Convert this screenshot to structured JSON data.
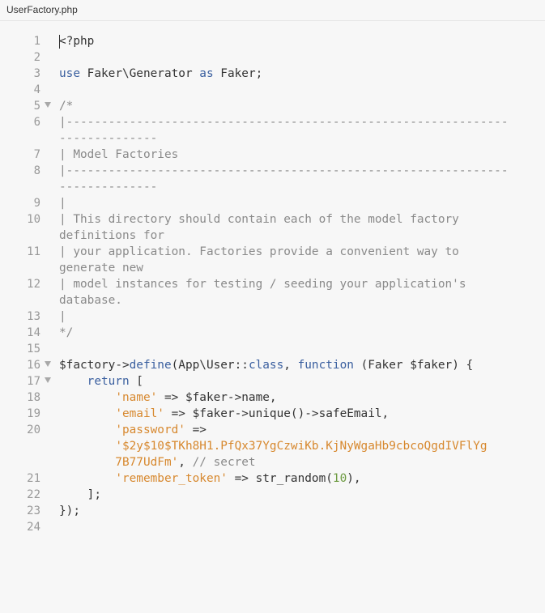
{
  "tab": {
    "title": "UserFactory.php"
  },
  "editor": {
    "lines": [
      {
        "num": "1",
        "fold": false,
        "rows": 1,
        "caret": true,
        "tokens": [
          {
            "t": "<?php",
            "c": "plain"
          }
        ]
      },
      {
        "num": "2",
        "fold": false,
        "rows": 1,
        "tokens": []
      },
      {
        "num": "3",
        "fold": false,
        "rows": 1,
        "tokens": [
          {
            "t": "use",
            "c": "kw"
          },
          {
            "t": " Faker\\Generator ",
            "c": "plain"
          },
          {
            "t": "as",
            "c": "kw"
          },
          {
            "t": " Faker;",
            "c": "plain"
          }
        ]
      },
      {
        "num": "4",
        "fold": false,
        "rows": 1,
        "tokens": []
      },
      {
        "num": "5",
        "fold": true,
        "rows": 1,
        "tokens": [
          {
            "t": "/*",
            "c": "com"
          }
        ]
      },
      {
        "num": "6",
        "fold": false,
        "rows": 2,
        "tokens": [
          {
            "t": "|---------------------------------------------------------------\n--------------",
            "c": "com"
          }
        ]
      },
      {
        "num": "7",
        "fold": false,
        "rows": 1,
        "tokens": [
          {
            "t": "| Model Factories",
            "c": "com"
          }
        ]
      },
      {
        "num": "8",
        "fold": false,
        "rows": 2,
        "tokens": [
          {
            "t": "|---------------------------------------------------------------\n--------------",
            "c": "com"
          }
        ]
      },
      {
        "num": "9",
        "fold": false,
        "rows": 1,
        "tokens": [
          {
            "t": "|",
            "c": "com"
          }
        ]
      },
      {
        "num": "10",
        "fold": false,
        "rows": 2,
        "tokens": [
          {
            "t": "| This directory should contain each of the model factory\ndefinitions for",
            "c": "com"
          }
        ]
      },
      {
        "num": "11",
        "fold": false,
        "rows": 2,
        "tokens": [
          {
            "t": "| your application. Factories provide a convenient way to\ngenerate new",
            "c": "com"
          }
        ]
      },
      {
        "num": "12",
        "fold": false,
        "rows": 2,
        "tokens": [
          {
            "t": "| model instances for testing / seeding your application's\ndatabase.",
            "c": "com"
          }
        ]
      },
      {
        "num": "13",
        "fold": false,
        "rows": 1,
        "tokens": [
          {
            "t": "|",
            "c": "com"
          }
        ]
      },
      {
        "num": "14",
        "fold": false,
        "rows": 1,
        "tokens": [
          {
            "t": "*/",
            "c": "com"
          }
        ]
      },
      {
        "num": "15",
        "fold": false,
        "rows": 1,
        "tokens": []
      },
      {
        "num": "16",
        "fold": true,
        "rows": 1,
        "tokens": [
          {
            "t": "$factory",
            "c": "var"
          },
          {
            "t": "->",
            "c": "plain"
          },
          {
            "t": "define",
            "c": "kw"
          },
          {
            "t": "(App\\User::",
            "c": "plain"
          },
          {
            "t": "class",
            "c": "kw"
          },
          {
            "t": ", ",
            "c": "plain"
          },
          {
            "t": "function",
            "c": "kw"
          },
          {
            "t": " (Faker $faker) {",
            "c": "plain"
          }
        ]
      },
      {
        "num": "17",
        "fold": true,
        "rows": 1,
        "tokens": [
          {
            "t": "    ",
            "c": "plain"
          },
          {
            "t": "return",
            "c": "kw"
          },
          {
            "t": " [",
            "c": "plain"
          }
        ]
      },
      {
        "num": "18",
        "fold": false,
        "rows": 1,
        "tokens": [
          {
            "t": "        ",
            "c": "plain"
          },
          {
            "t": "'name'",
            "c": "str"
          },
          {
            "t": " => $faker->name,",
            "c": "plain"
          }
        ]
      },
      {
        "num": "19",
        "fold": false,
        "rows": 1,
        "tokens": [
          {
            "t": "        ",
            "c": "plain"
          },
          {
            "t": "'email'",
            "c": "str"
          },
          {
            "t": " => $faker->unique()->safeEmail,",
            "c": "plain"
          }
        ]
      },
      {
        "num": "20",
        "fold": false,
        "rows": 3,
        "tokens": [
          {
            "t": "        ",
            "c": "plain"
          },
          {
            "t": "'password'",
            "c": "str"
          },
          {
            "t": " =>\n        ",
            "c": "plain"
          },
          {
            "t": "'$2y$10$TKh8H1.PfQx37YgCzwiKb.KjNyWgaHb9cbcoQgdIVFlYg\n        7B77UdFm'",
            "c": "str"
          },
          {
            "t": ", ",
            "c": "plain"
          },
          {
            "t": "// secret",
            "c": "com"
          }
        ]
      },
      {
        "num": "21",
        "fold": false,
        "rows": 1,
        "tokens": [
          {
            "t": "        ",
            "c": "plain"
          },
          {
            "t": "'remember_token'",
            "c": "str"
          },
          {
            "t": " => str_random(",
            "c": "plain"
          },
          {
            "t": "10",
            "c": "num"
          },
          {
            "t": "),",
            "c": "plain"
          }
        ]
      },
      {
        "num": "22",
        "fold": false,
        "rows": 1,
        "tokens": [
          {
            "t": "    ];",
            "c": "plain"
          }
        ]
      },
      {
        "num": "23",
        "fold": false,
        "rows": 1,
        "tokens": [
          {
            "t": "});",
            "c": "plain"
          }
        ]
      },
      {
        "num": "24",
        "fold": false,
        "rows": 1,
        "tokens": []
      }
    ]
  },
  "colors": {
    "background": "#f7f7f7",
    "keyword": "#3a5f9f",
    "string": "#d7882e",
    "comment": "#8a8a8a",
    "number": "#6c9a40",
    "line_number": "#999999"
  }
}
